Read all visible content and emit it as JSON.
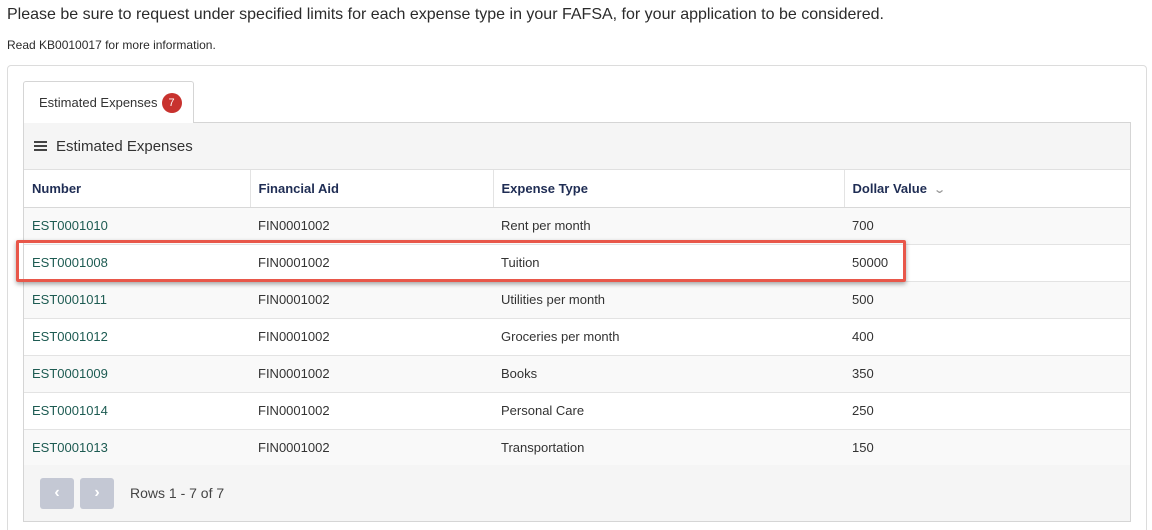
{
  "notice": "Please be sure to request under specified limits for each expense type in your FAFSA, for your application to be considered.",
  "subnotice": "Read KB0010017 for more information.",
  "tab": {
    "label": "Estimated Expenses",
    "badge": "7"
  },
  "list": {
    "title": "Estimated Expenses",
    "columns": [
      "Number",
      "Financial Aid",
      "Expense Type",
      "Dollar Value"
    ],
    "rows": [
      [
        "EST0001010",
        "FIN0001002",
        "Rent per month",
        "700"
      ],
      [
        "EST0001008",
        "FIN0001002",
        "Tuition",
        "50000"
      ],
      [
        "EST0001011",
        "FIN0001002",
        "Utilities per month",
        "500"
      ],
      [
        "EST0001012",
        "FIN0001002",
        "Groceries per month",
        "400"
      ],
      [
        "EST0001009",
        "FIN0001002",
        "Books",
        "350"
      ],
      [
        "EST0001014",
        "FIN0001002",
        "Personal Care",
        "250"
      ],
      [
        "EST0001013",
        "FIN0001002",
        "Transportation",
        "150"
      ]
    ]
  },
  "pagination": {
    "prev_icon": "chevron-left-icon",
    "next_icon": "chevron-right-icon",
    "rows_text": "Rows 1 - 7 of 7"
  },
  "icons": {
    "list_menu": "hamburger-menu-icon",
    "sort": "chevron-down-icon"
  },
  "colors": {
    "link": "#1d5b52",
    "badge": "#c8322e",
    "highlight": "#e8574a",
    "header_text": "#1f2d54"
  }
}
